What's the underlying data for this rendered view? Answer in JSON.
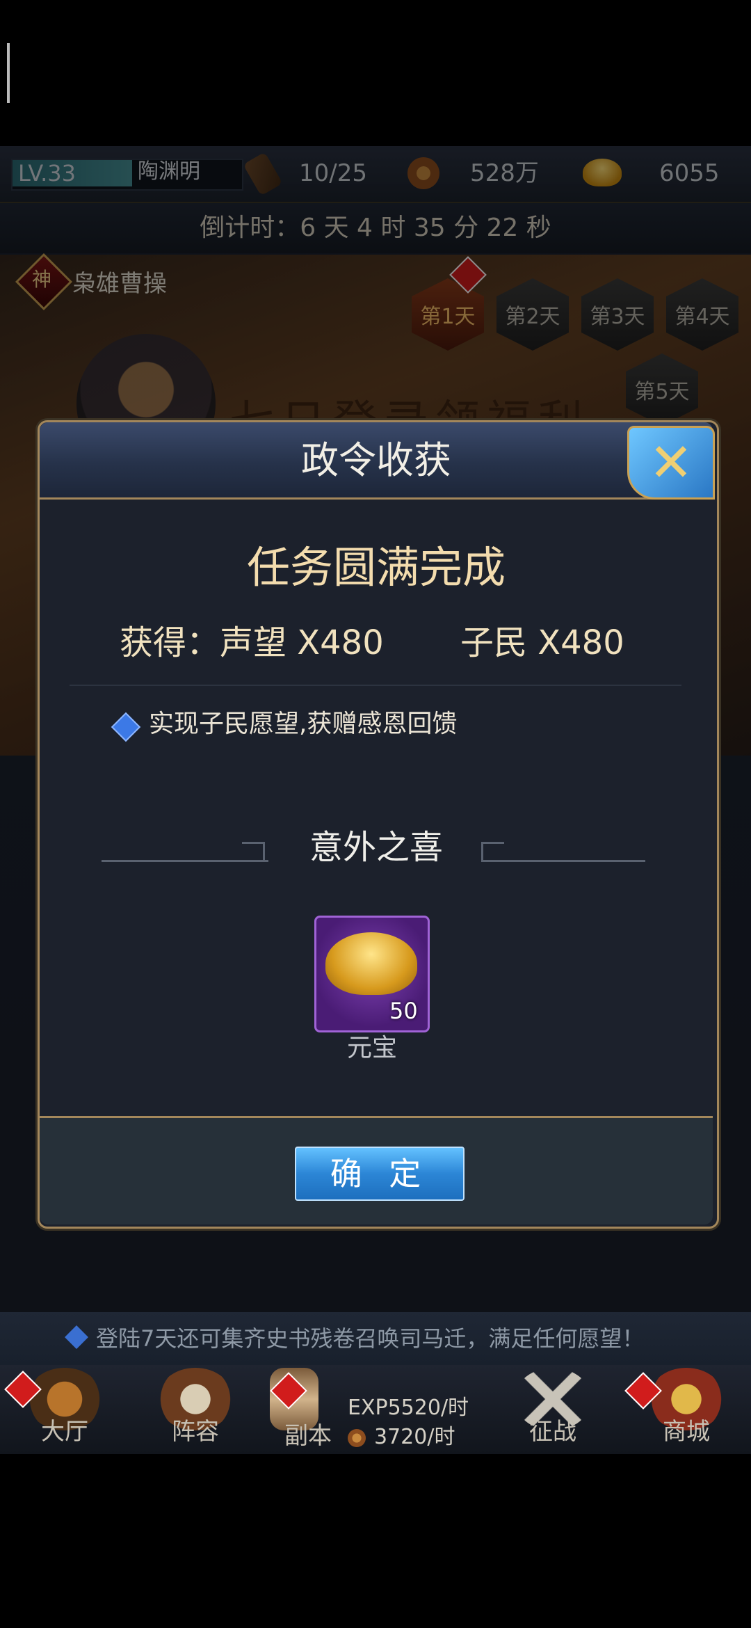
{
  "player": {
    "level": "LV.33",
    "name": "陶渊明"
  },
  "resources": {
    "stamina": "10/25",
    "coins": "528万",
    "ingots": "6055"
  },
  "countdown": "倒计时：6 天 4 时 35 分 22 秒",
  "banner": {
    "badge_char": "神",
    "title": "枭雄曹操",
    "script": "七日登录领福利",
    "days": [
      "第1天",
      "第2天",
      "第3天",
      "第4天",
      "第5天"
    ]
  },
  "dialog": {
    "title": "政令收获",
    "complete_title": "任务圆满完成",
    "reward_left": "获得：声望 X480",
    "reward_right": "子民 X480",
    "info": "实现子民愿望,获赠感恩回馈",
    "surprise_title": "意外之喜",
    "item": {
      "name": "元宝",
      "quantity": "50"
    },
    "confirm_label": "确 定",
    "close_icon": "✕"
  },
  "footer": {
    "notice": "登陆7天还可集齐史书残卷召唤司马迁，满足任何愿望！",
    "exp_rate": "EXP5520/时",
    "gold_rate": "3720/时",
    "nav": [
      "大厅",
      "阵容",
      "副本",
      "征战",
      "商城"
    ]
  },
  "colors": {
    "accent_gold": "#a3875b",
    "button_blue": "#2c86d6",
    "alert_red": "#d11c1c"
  }
}
